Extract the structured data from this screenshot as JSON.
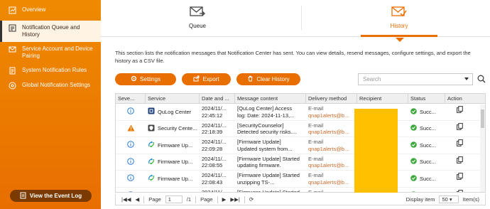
{
  "sidebar": {
    "items": [
      {
        "label": "Overview",
        "icon": "overview-icon"
      },
      {
        "label": "Notification Queue and History",
        "icon": "queue-history-icon",
        "active": true
      },
      {
        "label": "Service Account and Device Pairing",
        "icon": "service-account-icon"
      },
      {
        "label": "System Notification Rules",
        "icon": "rules-icon"
      },
      {
        "label": "Global Notification Settings",
        "icon": "global-settings-icon"
      }
    ],
    "event_log_label": "View the Event Log"
  },
  "tabs": [
    {
      "label": "Queue",
      "icon": "envelope-icon"
    },
    {
      "label": "History",
      "icon": "envelope-check-icon",
      "active": true
    }
  ],
  "description": "This section lists the notification messages that Notification Center has sent. You can view details, resend messages, configure settings, and export the history as a CSV file.",
  "toolbar": {
    "settings_label": "Settings",
    "export_label": "Export",
    "clear_label": "Clear History"
  },
  "search": {
    "placeholder": "Search"
  },
  "table": {
    "headers": [
      "Seve...",
      "Service",
      "Date and ...",
      "Message content",
      "Delivery method",
      "Recipient",
      "Status",
      "Action"
    ],
    "rows": [
      {
        "severity": "info",
        "service": "QuLog Center",
        "date": "2024/11/...",
        "time": "22:45:12",
        "msg1": "[QuLog Center] Access",
        "msg2": "log: Date: 2024-11-13,...",
        "method": "E-mail",
        "addr": "qnap1alerts@b...",
        "status": "Succ..."
      },
      {
        "severity": "warning",
        "service": "Security Cente...",
        "date": "2024/11/...",
        "time": "22:18:39",
        "msg1": "[SecurityCounselor]",
        "msg2": "Detected security risks....",
        "method": "E-mail",
        "addr": "qnap1alerts@b...",
        "status": "Succ..."
      },
      {
        "severity": "info",
        "service": "Firmware Up...",
        "date": "2024/11/...",
        "time": "22:09:28",
        "msg1": "[Firmware Update]",
        "msg2": "Updated system from...",
        "method": "E-mail",
        "addr": "qnap1alerts@b...",
        "status": "Succ..."
      },
      {
        "severity": "info",
        "service": "Firmware Up...",
        "date": "2024/11/...",
        "time": "22:08:55",
        "msg1": "[Firmware Update] Started",
        "msg2": "updating firmware.",
        "method": "E-mail",
        "addr": "qnap1alerts@b...",
        "status": "Succ..."
      },
      {
        "severity": "info",
        "service": "Firmware Up...",
        "date": "2024/11/...",
        "time": "22:08:43",
        "msg1": "[Firmware Update] Started",
        "msg2": "unzipping TS-...",
        "method": "E-mail",
        "addr": "qnap1alerts@b...",
        "status": "Succ..."
      },
      {
        "severity": "info",
        "service": "Firmware Un...",
        "date": "2024/11/...",
        "time": "",
        "msg1": "[Firmware Update] Started",
        "msg2": "",
        "method": "E-mail",
        "addr": "",
        "status": "Succ..."
      }
    ]
  },
  "pager": {
    "page_label": "Page",
    "page_value": "1",
    "total": "/1",
    "page_label2": "Page",
    "display_label": "Display item",
    "per_page": "50",
    "items_label": "Item(s)"
  },
  "colors": {
    "accent": "#e86e00",
    "recipient_redact": "#ffc000"
  }
}
